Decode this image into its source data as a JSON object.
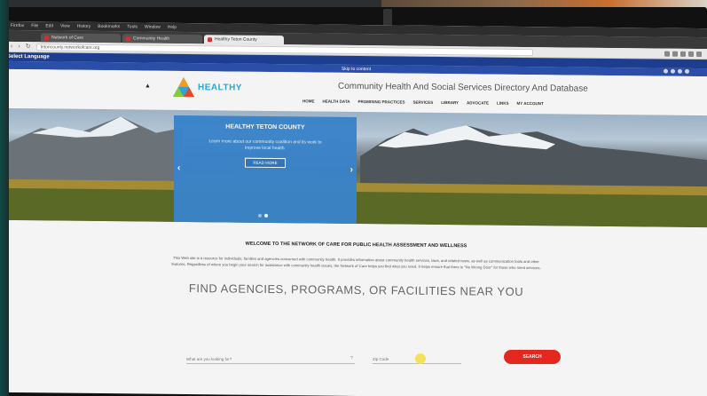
{
  "browser": {
    "menu": [
      "Firefox",
      "File",
      "Edit",
      "View",
      "History",
      "Bookmarks",
      "Tools",
      "Window",
      "Help"
    ],
    "tabs": [
      {
        "label": "Network of Care"
      },
      {
        "label": "Community Health"
      },
      {
        "label": "Healthy Teton County"
      }
    ],
    "url": "tetoncounty.networkofcare.org"
  },
  "page": {
    "language_label": "Select Language",
    "skip_label": "Skip to content",
    "logo_text": "HEALTHY",
    "site_title": "Community Health And Social Services Directory And Database",
    "nav": [
      "HOME",
      "HEALTH DATA",
      "PROMISING PRACTICES",
      "SERVICES",
      "LIBRARY",
      "ADVOCATE",
      "LINKS",
      "MY ACCOUNT"
    ],
    "hero": {
      "title": "HEALTHY TETON COUNTY",
      "text": "Learn more about our community coalition and its work to improve local health.",
      "button": "READ MORE"
    },
    "welcome": {
      "title": "WELCOME TO THE NETWORK OF CARE FOR PUBLIC HEALTH ASSESSMENT AND WELLNESS",
      "body": "This Web site is a resource for individuals, families and agencies concerned with community health. It provides information about community health services, laws, and related news, as well as communication tools and other features. Regardless of where you begin your search for assistance with community health issues, the Network of Care helps you find what you need. It helps ensure that there is \"No Wrong Door\" for those who need services."
    },
    "find_heading": "FIND AGENCIES, PROGRAMS, OR FACILITIES NEAR YOU",
    "search": {
      "placeholder": "What are you looking for?",
      "zip_placeholder": "Zip Code",
      "button": "SEARCH"
    }
  },
  "colors": {
    "top_bar": "#1d3d8f",
    "hero_card": "#3a84c9",
    "search_button": "#e42820",
    "logo_text": "#2aa7d8"
  }
}
